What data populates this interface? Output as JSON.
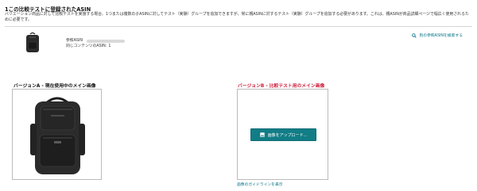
{
  "header": {
    "title": "1この比較テストに登録されたASIN",
    "description": "バリエーション商品に対して比較テストを実施する場合、1つまたは複数の子ASINに対してテスト（実験）グループを追加できますが、常に親ASINに対するテスト（実験）グループを追加する必要があります。これは、親ASINが商品詳細ページで幅広く使用されるために必要です。"
  },
  "asin_row": {
    "reference_label": "参照ASIN",
    "same_content_label": "同じコンテンツのASIN:",
    "same_content_count": "1",
    "search_link": "別の参照ASINを検索する",
    "thumbnail_icon": "backpack-thumbnail"
  },
  "version_a": {
    "title": "バージョンA - 現在使用中のメイン画像",
    "image_icon": "backpack-image"
  },
  "version_b": {
    "title": "バージョンB - 比較テスト用のメイン画像",
    "upload_button": "画像をアップロード...",
    "upload_icon": "image-upload-icon"
  },
  "guideline_link": "画像のガイドラインを表示",
  "colors": {
    "accent_teal": "#117d86",
    "link": "#007185",
    "version_b_red": "#cc1c39"
  }
}
